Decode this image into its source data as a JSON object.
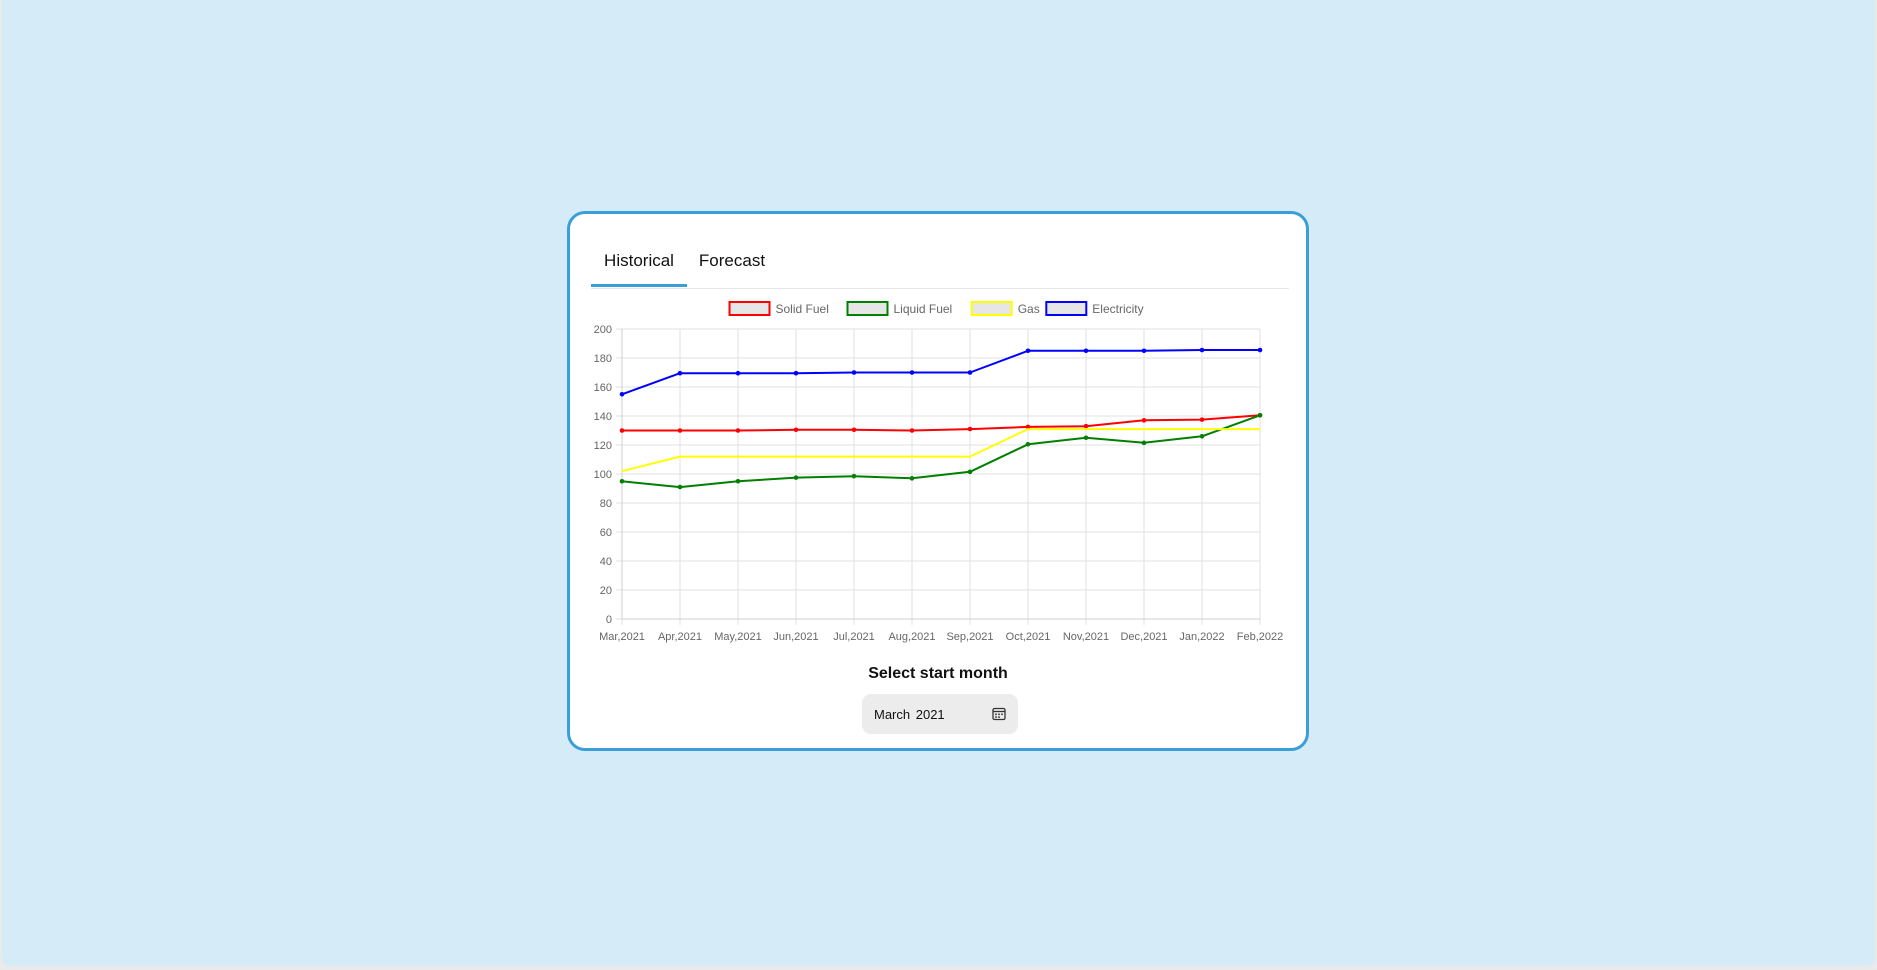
{
  "tabs": [
    {
      "label": "Historical",
      "active": true
    },
    {
      "label": "Forecast",
      "active": false
    }
  ],
  "picker": {
    "label": "Select start month",
    "value": "March 2021",
    "icon": "calendar-icon"
  },
  "colors": {
    "accent": "#3a9ed9",
    "page_background": "#d6ebf8"
  },
  "chart_data": {
    "type": "line",
    "categories": [
      "Mar,2021",
      "Apr,2021",
      "May,2021",
      "Jun,2021",
      "Jul,2021",
      "Aug,2021",
      "Sep,2021",
      "Oct,2021",
      "Nov,2021",
      "Dec,2021",
      "Jan,2022",
      "Feb,2022"
    ],
    "ylim": [
      0,
      200
    ],
    "yticks": [
      0,
      20,
      40,
      60,
      80,
      100,
      120,
      140,
      160,
      180,
      200
    ],
    "grid": true,
    "legend": "top-center",
    "series": [
      {
        "name": "Solid Fuel",
        "color": "#ff0000",
        "markers": true,
        "values": [
          130,
          130,
          130,
          130.5,
          130.5,
          130,
          131,
          132.5,
          133,
          137,
          137.5,
          140.5
        ]
      },
      {
        "name": "Liquid Fuel",
        "color": "#008000",
        "markers": true,
        "values": [
          95,
          91,
          95,
          97.5,
          98.5,
          97,
          101.5,
          120.5,
          125,
          121.5,
          126,
          140.5
        ]
      },
      {
        "name": "Gas",
        "color": "#ffff00",
        "markers": false,
        "values": [
          102,
          112,
          112,
          112,
          112,
          112,
          112,
          131,
          131,
          131,
          131,
          131
        ]
      },
      {
        "name": "Electricity",
        "color": "#0000ff",
        "markers": true,
        "values": [
          155,
          169.5,
          169.5,
          169.5,
          170,
          170,
          170,
          185,
          185,
          185,
          185.5,
          185.5
        ]
      }
    ]
  }
}
